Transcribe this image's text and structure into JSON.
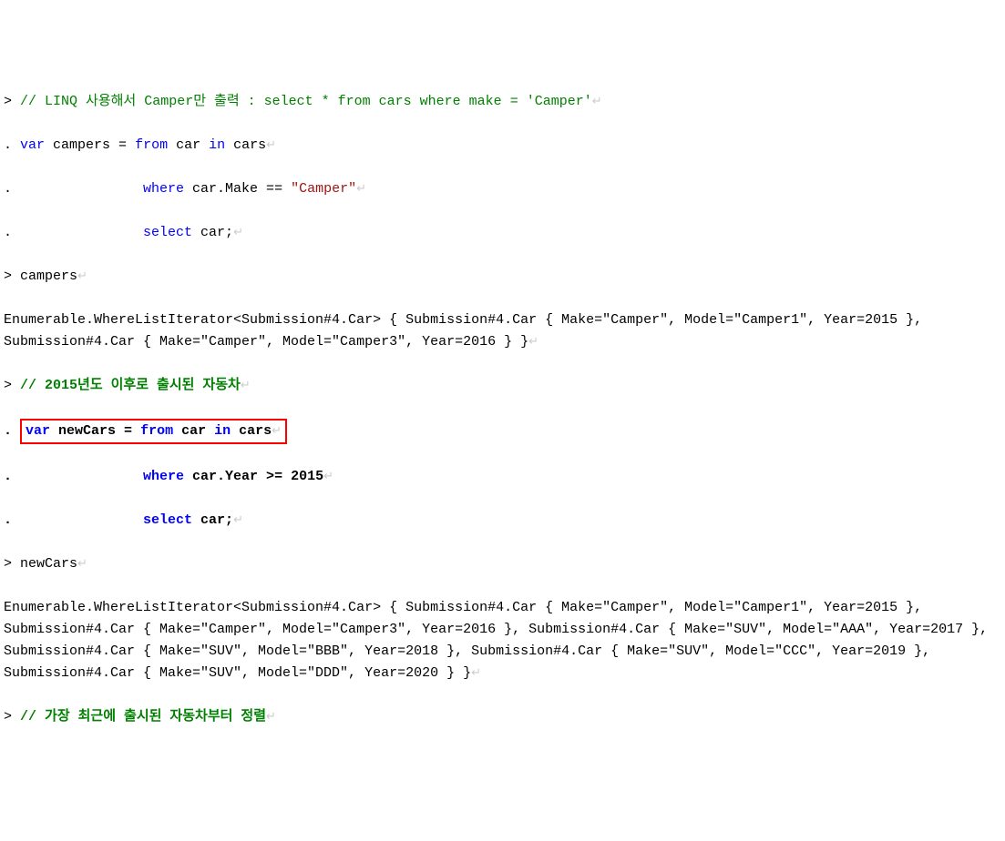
{
  "lines": {
    "l1": {
      "prompt": "> ",
      "comment": "// LINQ 사용해서 Camper만 출력 : select * from cars where make = 'Camper'"
    },
    "l2": {
      "prompt": ". ",
      "kw_var": "var",
      "text1": " campers = ",
      "kw_from": "from",
      "text2": " car ",
      "kw_in": "in",
      "text3": " cars"
    },
    "l3": {
      "prompt": ".                ",
      "kw_where": "where",
      "text1": " car.Make == ",
      "string": "\"Camper\""
    },
    "l4": {
      "prompt": ".                ",
      "kw_select": "select",
      "text1": " car;"
    },
    "l5": {
      "prompt": "> ",
      "text": "campers"
    },
    "l6": {
      "text": "Enumerable.WhereListIterator<Submission#4.Car> { Submission#4.Car { Make=\"Camper\", Model=\"Camper1\", Year=2015 }, Submission#4.Car { Make=\"Camper\", Model=\"Camper3\", Year=2016 } }"
    },
    "l7": {
      "prompt": "> ",
      "comment": "// 2015년도 이후로 출시된 자동차"
    },
    "l8": {
      "prompt": ". ",
      "kw_var": "var",
      "text1": " newCars = ",
      "kw_from": "from",
      "text2": " car ",
      "kw_in": "in",
      "text3": " cars"
    },
    "l9": {
      "prompt": ".                ",
      "kw_where": "where",
      "text1": " car.Year >= 2015"
    },
    "l10": {
      "prompt": ".                ",
      "kw_select": "select",
      "text1": " car;"
    },
    "l11": {
      "prompt": "> ",
      "text": "newCars"
    },
    "l12": {
      "text": "Enumerable.WhereListIterator<Submission#4.Car> { Submission#4.Car { Make=\"Camper\", Model=\"Camper1\", Year=2015 }, Submission#4.Car { Make=\"Camper\", Model=\"Camper3\", Year=2016 }, Submission#4.Car { Make=\"SUV\", Model=\"AAA\", Year=2017 }, Submission#4.Car { Make=\"SUV\", Model=\"BBB\", Year=2018 }, Submission#4.Car { Make=\"SUV\", Model=\"CCC\", Year=2019 }, Submission#4.Car { Make=\"SUV\", Model=\"DDD\", Year=2020 } }"
    },
    "l13": {
      "prompt": "> ",
      "comment": "// 가장 최근에 출시된 자동차부터 정렬"
    }
  },
  "eol": "↵"
}
